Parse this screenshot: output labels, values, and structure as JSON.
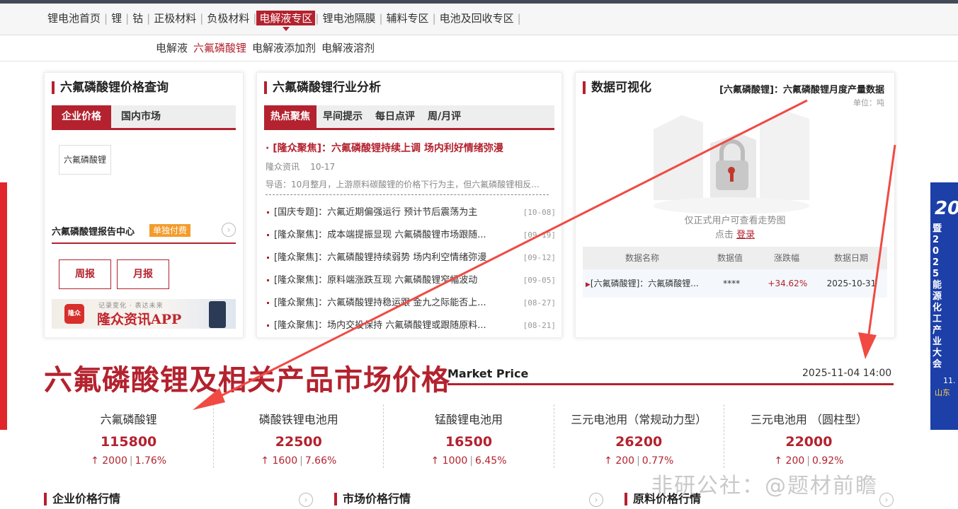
{
  "nav_primary": {
    "items": [
      "锂电池首页",
      "锂",
      "钴",
      "正极材料",
      "负极材料",
      "电解液专区",
      "锂电池隔膜",
      "辅料专区",
      "电池及回收专区"
    ],
    "active_index": 5
  },
  "nav_secondary": {
    "items": [
      "电解液",
      "六氟磷酸锂",
      "电解液添加剂",
      "电解液溶剂"
    ],
    "active_index": 1
  },
  "price_query": {
    "title": "六氟磷酸锂价格查询",
    "tabs": [
      "企业价格",
      "国内市场"
    ],
    "product_chip": "六氟磷酸锂",
    "report_center": "六氟磷酸锂报告中心",
    "paid_badge": "单独付费",
    "weekly": "周报",
    "monthly": "月报",
    "ad_slogan": "记录变化 · 表达未来",
    "ad_brand": "隆众资讯APP",
    "ad_logo": "隆众"
  },
  "analysis": {
    "title": "六氟磷酸锂行业分析",
    "tabs": [
      "热点聚焦",
      "早间提示",
      "每日点评",
      "周/月评"
    ],
    "featured": {
      "headline": "· [隆众聚焦]：六氟磷酸锂持续上调 场内利好情绪弥漫",
      "source": "隆众资讯",
      "date": "10-17",
      "summary": "导语：10月整月，上游原料碳酸锂的价格下行为主，但六氟磷酸锂相反..."
    },
    "list": [
      {
        "text": "[国庆专题]：六氟近期偏强运行 预计节后震荡为主",
        "date": "[10-08]"
      },
      {
        "text": "[隆众聚焦]：成本端提振显现 六氟磷酸锂市场跟随...",
        "date": "[09-19]"
      },
      {
        "text": "[隆众聚焦]：六氟磷酸锂持续弱势 场内利空情绪弥漫",
        "date": "[09-12]"
      },
      {
        "text": "[隆众聚焦]：原料端涨跌互现 六氟磷酸锂窄幅波动",
        "date": "[09-05]"
      },
      {
        "text": "[隆众聚焦]：六氟磷酸锂持稳运跟 金九之际能否上...",
        "date": "[08-27]"
      },
      {
        "text": "[隆众聚焦]：场内交投保持 六氟磷酸锂或跟随原料...",
        "date": "[08-21]"
      }
    ]
  },
  "viz": {
    "title": "数据可视化",
    "chart_title": "[六氟磷酸锂]：六氟磷酸锂月度产量数据",
    "unit": "单位：吨",
    "locked_text": "仅正式用户可查看走势图",
    "click_text": "点击",
    "login": "登录",
    "table_headers": [
      "数据名称",
      "数据值",
      "涨跌幅",
      "数据日期"
    ],
    "table_row": [
      "[六氟磷酸锂]：六氟磷酸锂...",
      "****",
      "+34.62%",
      "2025-10-31"
    ]
  },
  "market": {
    "title": "六氟磷酸锂及相关产品市场价格",
    "subtitle": "Market Price",
    "datetime": "2025-11-04 14:00",
    "items": [
      {
        "name": "六氟磷酸锂",
        "value": "115800",
        "change": "↑ 2000",
        "pct": "1.76%"
      },
      {
        "name": "磷酸铁锂电池用",
        "value": "22500",
        "change": "↑ 1600",
        "pct": "7.66%"
      },
      {
        "name": "锰酸锂电池用",
        "value": "16500",
        "change": "↑ 1000",
        "pct": "6.45%"
      },
      {
        "name": "三元电池用（常规动力型）",
        "value": "26200",
        "change": "↑ 200",
        "pct": "0.77%"
      },
      {
        "name": "三元电池用 （圆柱型）",
        "value": "22000",
        "change": "↑ 200",
        "pct": "0.92%"
      }
    ]
  },
  "sections": [
    "企业价格行情",
    "市场价格行情",
    "原料价格行情"
  ],
  "watermark": "非研公社：@题材前瞻",
  "right_banner": {
    "top": "20",
    "text": "暨2025能源化工产业大会",
    "bottom": "11.",
    "city": "山东"
  },
  "colors": {
    "accent": "#b3222e",
    "arrow": "#f04a43"
  }
}
